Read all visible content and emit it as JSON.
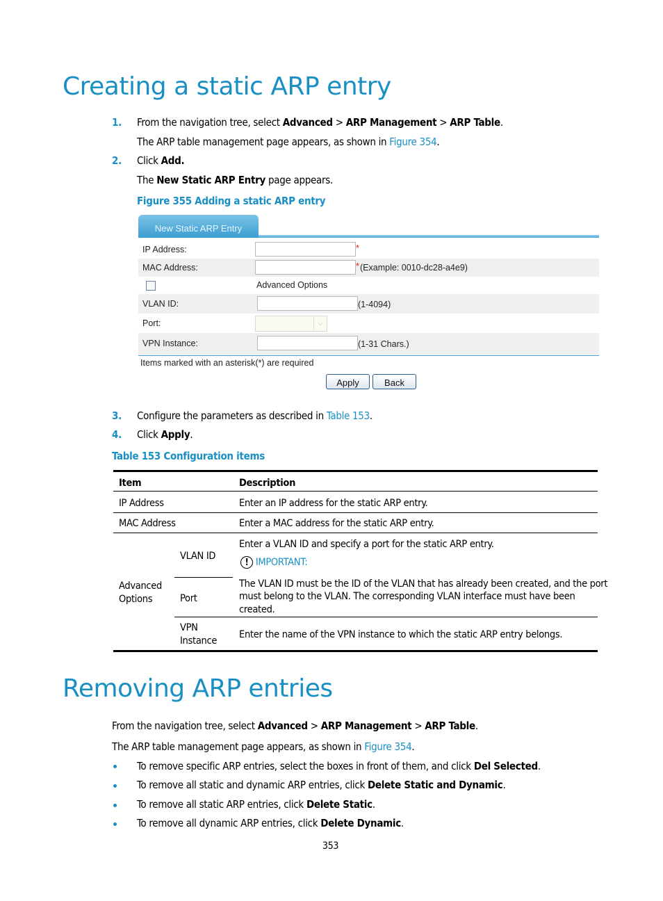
{
  "section1": {
    "title": "Creating a static ARP entry",
    "steps": [
      {
        "num": "1.",
        "pre": "From the navigation tree, select ",
        "b1": "Advanced",
        "s1": " > ",
        "b2": "ARP Management",
        "s2": " > ",
        "b3": "ARP Table",
        "post": "."
      },
      {
        "num": "2.",
        "pre": "Click ",
        "b1": "Add."
      },
      {
        "num": "3.",
        "pre": "Configure the parameters as described in ",
        "link": "Table 153",
        "post": "."
      },
      {
        "num": "4.",
        "pre": "Click ",
        "b1": "Apply",
        "post": "."
      }
    ],
    "step1_note": {
      "pre": "The ARP table management page appears, as shown in ",
      "link": "Figure 354",
      "post": "."
    },
    "step2_note": {
      "pre": "The ",
      "b": "New Static ARP Entry",
      "post": " page appears."
    },
    "figure_caption": "Figure 355 Adding a static ARP entry",
    "table_caption": "Table 153 Configuration items"
  },
  "form": {
    "tab_label": "New Static ARP Entry",
    "ip_label": "IP Address:",
    "mac_label": "MAC Address:",
    "required_mark": "*",
    "mac_hint": "(Example: 0010-dc28-a4e9)",
    "advanced_label": "Advanced Options",
    "advanced_checked": false,
    "vlan_label": "VLAN ID:",
    "vlan_hint": "(1-4094)",
    "port_label": "Port:",
    "port_value": "",
    "vpn_label": "VPN Instance:",
    "vpn_hint": "(1-31 Chars.)",
    "ip_value": "",
    "mac_value": "",
    "vlan_value": "",
    "vpn_value": "",
    "required_note": "Items marked with an asterisk(*) are required",
    "apply_label": "Apply",
    "back_label": "Back",
    "dropdown_icon": "chevron-down-icon"
  },
  "table": {
    "headers": [
      "Item",
      "Description"
    ],
    "rows": [
      {
        "item": "IP Address",
        "desc": "Enter an IP address for the static ARP entry."
      },
      {
        "item": "MAC Address",
        "desc": "Enter a MAC address for the static ARP entry."
      }
    ],
    "group": {
      "label_line1": "Advanced",
      "label_line2": "Options",
      "vlan": "VLAN ID",
      "port": "Port",
      "vpn_line1": "VPN",
      "vpn_line2": "Instance",
      "vlan_port_desc": "Enter a VLAN ID and specify a port for the static ARP entry.",
      "important_icon": "exclamation-circle-icon",
      "important_label": "IMPORTANT:",
      "important_lines": [
        "The VLAN ID must be the ID of the VLAN that has already been created, and the port",
        "must belong to the VLAN. The corresponding VLAN interface must have been",
        "created."
      ],
      "vpn_desc": "Enter the name of the VPN instance to which the static ARP entry belongs."
    }
  },
  "section2": {
    "title": "Removing ARP entries",
    "intro": {
      "pre": "From the navigation tree, select ",
      "b1": "Advanced",
      "s1": " > ",
      "b2": "ARP Management",
      "s2": " > ",
      "b3": "ARP Table",
      "post": "."
    },
    "note": {
      "pre": "The ARP table management page appears, as shown in ",
      "link": "Figure 354",
      "post": "."
    },
    "bullets": [
      {
        "pre": "To remove specific ARP entries, select the boxes in front of them, and click ",
        "b": "Del Selected",
        "post": "."
      },
      {
        "pre": "To remove all static and dynamic ARP entries, click ",
        "b": "Delete Static and Dynamic",
        "post": "."
      },
      {
        "pre": "To remove all static ARP entries, click ",
        "b": "Delete Static",
        "post": "."
      },
      {
        "pre": "To remove all dynamic ARP entries, click ",
        "b": "Delete Dynamic",
        "post": "."
      }
    ]
  },
  "page_number": "353"
}
